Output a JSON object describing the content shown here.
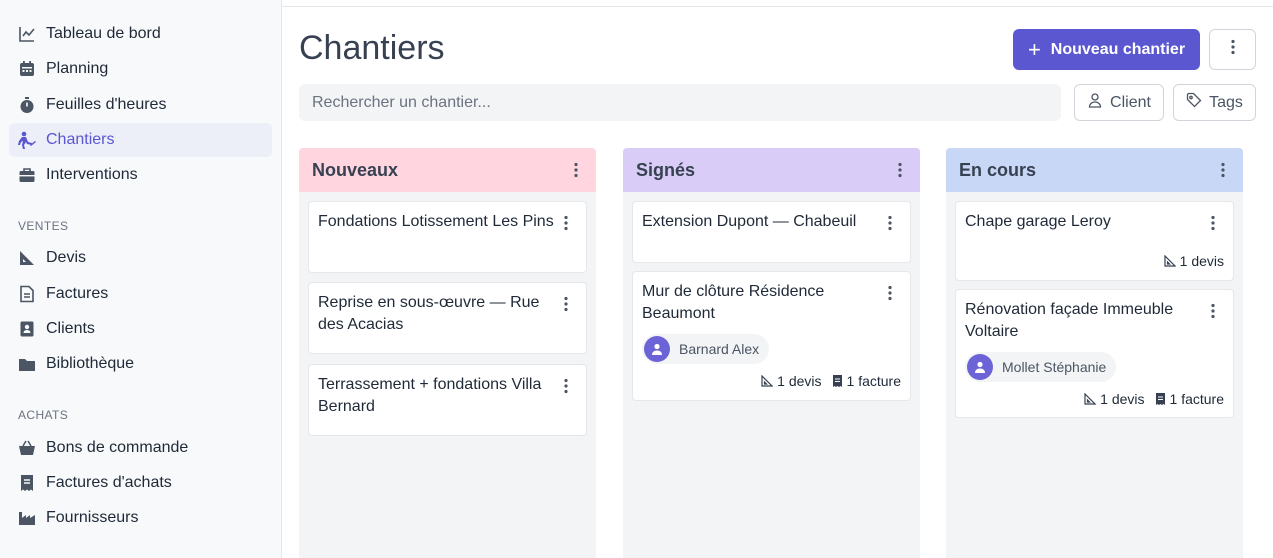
{
  "sidebar": {
    "nav": [
      {
        "label": "Tableau de bord",
        "icon": "chart-line-icon"
      },
      {
        "label": "Planning",
        "icon": "calendar-icon"
      },
      {
        "label": "Feuilles d'heures",
        "icon": "stopwatch-icon"
      },
      {
        "label": "Chantiers",
        "icon": "worker-icon",
        "active": true
      },
      {
        "label": "Interventions",
        "icon": "toolbox-icon"
      }
    ],
    "ventes_title": "VENTES",
    "ventes": [
      {
        "label": "Devis",
        "icon": "ruler-icon"
      },
      {
        "label": "Factures",
        "icon": "invoice-icon"
      },
      {
        "label": "Clients",
        "icon": "contact-icon"
      },
      {
        "label": "Bibliothèque",
        "icon": "folder-icon"
      }
    ],
    "achats_title": "ACHATS",
    "achats": [
      {
        "label": "Bons de commande",
        "icon": "basket-icon"
      },
      {
        "label": "Factures d'achats",
        "icon": "receipt-icon"
      },
      {
        "label": "Fournisseurs",
        "icon": "factory-icon"
      }
    ]
  },
  "header": {
    "title": "Chantiers",
    "new_button": "Nouveau chantier",
    "search_placeholder": "Rechercher un chantier...",
    "filter_client": "Client",
    "filter_tags": "Tags"
  },
  "columns": [
    {
      "title": "Nouveaux",
      "color": "#ffd6e0",
      "cards": [
        {
          "title": "Fondations Lotissement Les Pins"
        },
        {
          "title": "Reprise en sous-œuvre — Rue des Acacias"
        },
        {
          "title": "Terrassement + fondations Villa Bernard"
        }
      ]
    },
    {
      "title": "Signés",
      "color": "#d9ccf7",
      "cards": [
        {
          "title": "Extension Dupont — Chabeuil"
        },
        {
          "title": "Mur de clôture Résidence Beaumont",
          "client": "Barnard Alex",
          "devis": "1 devis",
          "facture": "1 facture"
        }
      ]
    },
    {
      "title": "En cours",
      "color": "#c9d7f7",
      "cards": [
        {
          "title": "Chape garage Leroy",
          "devis": "1 devis"
        },
        {
          "title": "Rénovation façade Immeuble Voltaire",
          "client": "Mollet Stéphanie",
          "devis": "1 devis",
          "facture": "1 facture"
        }
      ]
    }
  ]
}
